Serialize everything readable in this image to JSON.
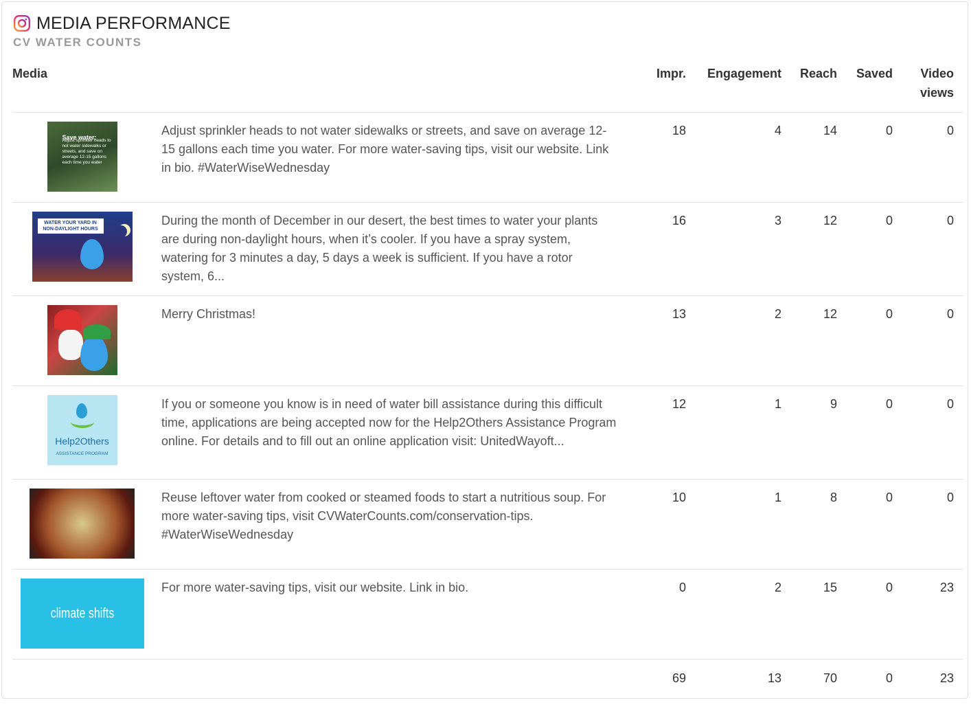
{
  "header": {
    "title": "MEDIA PERFORMANCE",
    "subtitle": "CV WATER COUNTS",
    "icon": "instagram-icon"
  },
  "columns": {
    "media": "Media",
    "impr": "Impr.",
    "engagement": "Engagement",
    "reach": "Reach",
    "saved": "Saved",
    "video_views": "Video views"
  },
  "rows": [
    {
      "thumb_alt": "Save water: Adjust sprinkler heads to not water sidewalks or streets, and save on average 12-15 gallons each time you water",
      "thumb_text_1": "Save water:",
      "thumb_text_2": "Adjust sprinkler heads to not water sidewalks or streets, and save on average 12-15 gallons each time you water",
      "caption": "Adjust sprinkler heads to not water sidewalks or streets, and save on average 12-15 gallons each time you water. For more water-saving tips, visit our website. Link in bio. #WaterWiseWednesday",
      "impr": "18",
      "engagement": "4",
      "reach": "14",
      "saved": "0",
      "video_views": "0"
    },
    {
      "thumb_text_1": "WATER YOUR YARD IN NON-DAYLIGHT HOURS",
      "caption": "During the month of December in our desert, the best times to water your plants are during non-daylight hours, when it’s cooler. If you have a spray system, watering for 3 minutes a day, 5 days a week is sufficient. If you have a rotor system, 6...",
      "impr": "16",
      "engagement": "3",
      "reach": "12",
      "saved": "0",
      "video_views": "0"
    },
    {
      "caption": "Merry Christmas!",
      "impr": "13",
      "engagement": "2",
      "reach": "12",
      "saved": "0",
      "video_views": "0"
    },
    {
      "thumb_text_1": "Help2Others",
      "thumb_text_2": "ASSISTANCE PROGRAM",
      "caption": "If you or someone you know is in need of water bill assistance during this difficult time, applications are being accepted now for the Help2Others Assistance Program online. For details and to fill out an online application visit: UnitedWayoft...",
      "impr": "12",
      "engagement": "1",
      "reach": "9",
      "saved": "0",
      "video_views": "0"
    },
    {
      "caption": "Reuse leftover water from cooked or steamed foods to start a nutritious soup. For more water-saving tips, visit CVWaterCounts.com/conservation-tips. #WaterWiseWednesday",
      "impr": "10",
      "engagement": "1",
      "reach": "8",
      "saved": "0",
      "video_views": "0"
    },
    {
      "thumb_text_1": "climate shifts",
      "caption": "For more water-saving tips, visit our website. Link in bio.",
      "impr": "0",
      "engagement": "2",
      "reach": "15",
      "saved": "0",
      "video_views": "23"
    }
  ],
  "totals": {
    "impr": "69",
    "engagement": "13",
    "reach": "70",
    "saved": "0",
    "video_views": "23"
  },
  "colors": {
    "border": "#e3e3e3",
    "subtitle": "#9a9a9a",
    "climate_bg": "#29c0e6"
  }
}
